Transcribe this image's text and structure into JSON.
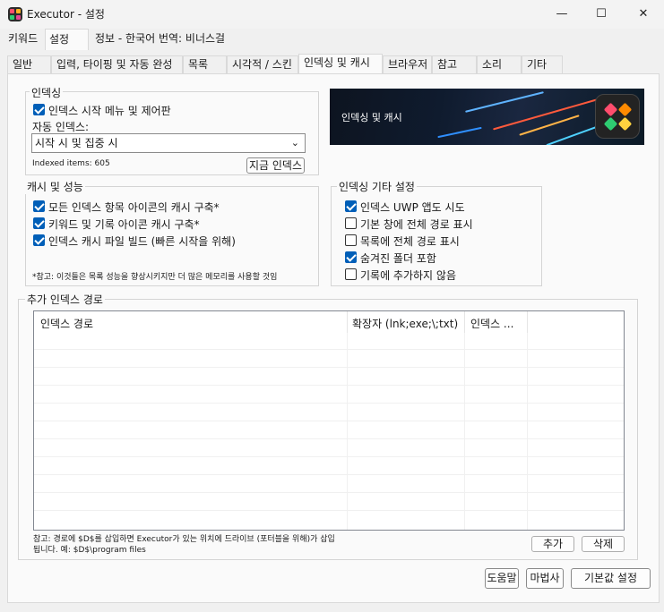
{
  "window": {
    "title": "Executor - 설정",
    "minimize": "—",
    "maximize": "☐",
    "close": "✕"
  },
  "top_tabs": [
    "키워드",
    "설정",
    "정보 - 한국어 번역: 비너스걸"
  ],
  "sub_tabs": [
    "일반",
    "입력, 타이핑 및 자동 완성",
    "목록",
    "시각적 / 스킨",
    "인덱싱 및 캐시",
    "브라우저",
    "참고",
    "소리",
    "기타"
  ],
  "indexing": {
    "title": "인덱싱",
    "start_menu_label": "인덱스 시작 메뉴 및 제어판",
    "start_menu_checked": true,
    "auto_index_label": "자동 인덱스:",
    "auto_index_value": "시작 시 및 집중 시",
    "indexed_items": "Indexed items: 605",
    "index_now": "지금 인덱스"
  },
  "banner": {
    "title": "인덱싱 및 캐시"
  },
  "cache": {
    "title": "캐시 및 성능",
    "options": [
      {
        "label": "모든 인덱스 항목 아이콘의 캐시 구축*",
        "checked": true
      },
      {
        "label": "키워드 및 기록 아이콘 캐시 구축*",
        "checked": true
      },
      {
        "label": "인덱스 캐시 파일 빌드 (빠른 시작을 위해)",
        "checked": true
      }
    ],
    "note": "*참고: 이것들은 목록 성능을 향상시키지만 더 많은 메모리를 사용할 것임"
  },
  "misc": {
    "title": "인덱싱 기타 설정",
    "options": [
      {
        "label": "인덱스 UWP 앱도 시도",
        "checked": true
      },
      {
        "label": "기본 창에 전체 경로 표시",
        "checked": false
      },
      {
        "label": "목록에 전체 경로 표시",
        "checked": false
      },
      {
        "label": "숨겨진 폴더 포함",
        "checked": true
      },
      {
        "label": "기록에 추가하지 않음",
        "checked": false
      }
    ]
  },
  "paths": {
    "title": "추가 인덱스 경로",
    "columns": [
      "인덱스 경로",
      "확장자 (lnk;exe;\\;txt)",
      "인덱스 ..."
    ],
    "note_line1": "참고: 경로에 $D$를 삽입하면 Executor가 있는 위치에 드라이브 (포터블을 위해)가 삽입",
    "note_line2": "됩니다. 예: $D$\\program files",
    "add": "추가",
    "delete": "삭제"
  },
  "footer": {
    "help": "도움말",
    "wizard": "마법사",
    "defaults": "기본값 설정"
  },
  "colors": {
    "accent": "#005fb8"
  }
}
